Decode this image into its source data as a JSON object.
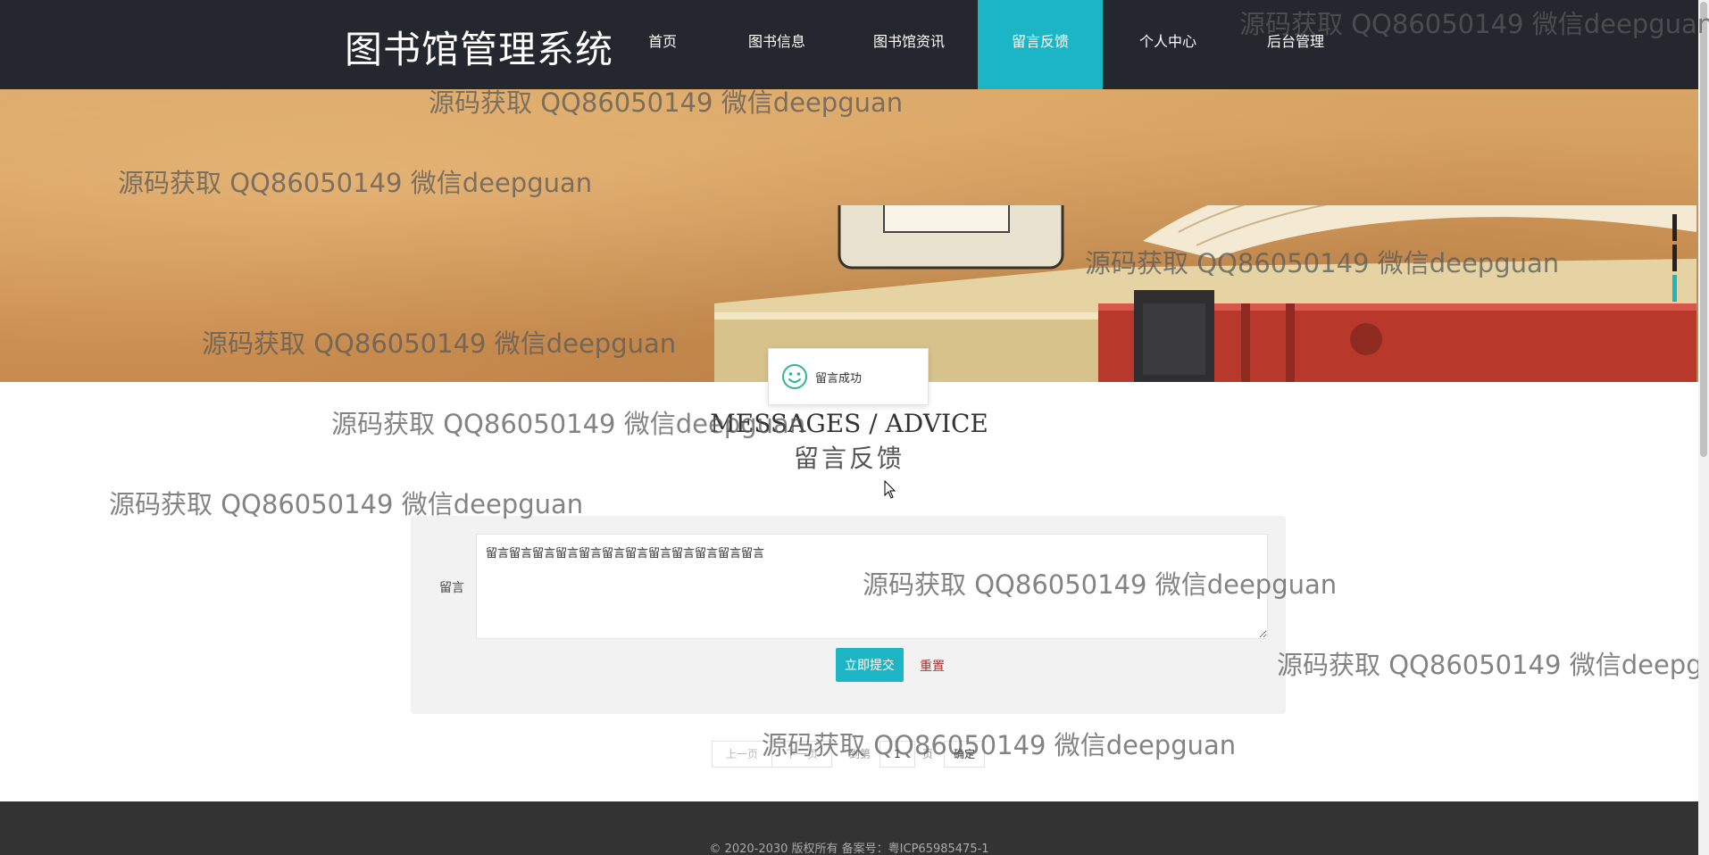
{
  "app": {
    "logo": "图书馆管理系统"
  },
  "nav": {
    "items": [
      {
        "label": "首页"
      },
      {
        "label": "图书信息"
      },
      {
        "label": "图书馆资讯"
      },
      {
        "label": "留言反馈"
      },
      {
        "label": "个人中心"
      },
      {
        "label": "后台管理"
      }
    ],
    "active_index": 3
  },
  "toast": {
    "icon": "smile-icon",
    "text": "留言成功"
  },
  "heading": {
    "en": "MESSAGES / ADVICE",
    "cn": "留言反馈"
  },
  "form": {
    "label": "留言",
    "value": "留言留言留言留言留言留言留言留言留言留言留言留言",
    "submit_label": "立即提交",
    "reset_label": "重置"
  },
  "pager": {
    "prev_label": "上一页",
    "next_label": "下一页",
    "goto_label": "到第",
    "page_value": "1",
    "page_suffix": "页",
    "confirm_label": "确定"
  },
  "footer": {
    "text": "© 2020-2030 版权所有 备案号：粤ICP65985475-1"
  },
  "watermark": {
    "text": "源码获取 QQ86050149 微信deepguan"
  },
  "colors": {
    "nav_bg": "#24272e",
    "accent": "#1cb5c6",
    "reset": "#cc2020",
    "footer_bg": "#333333"
  }
}
